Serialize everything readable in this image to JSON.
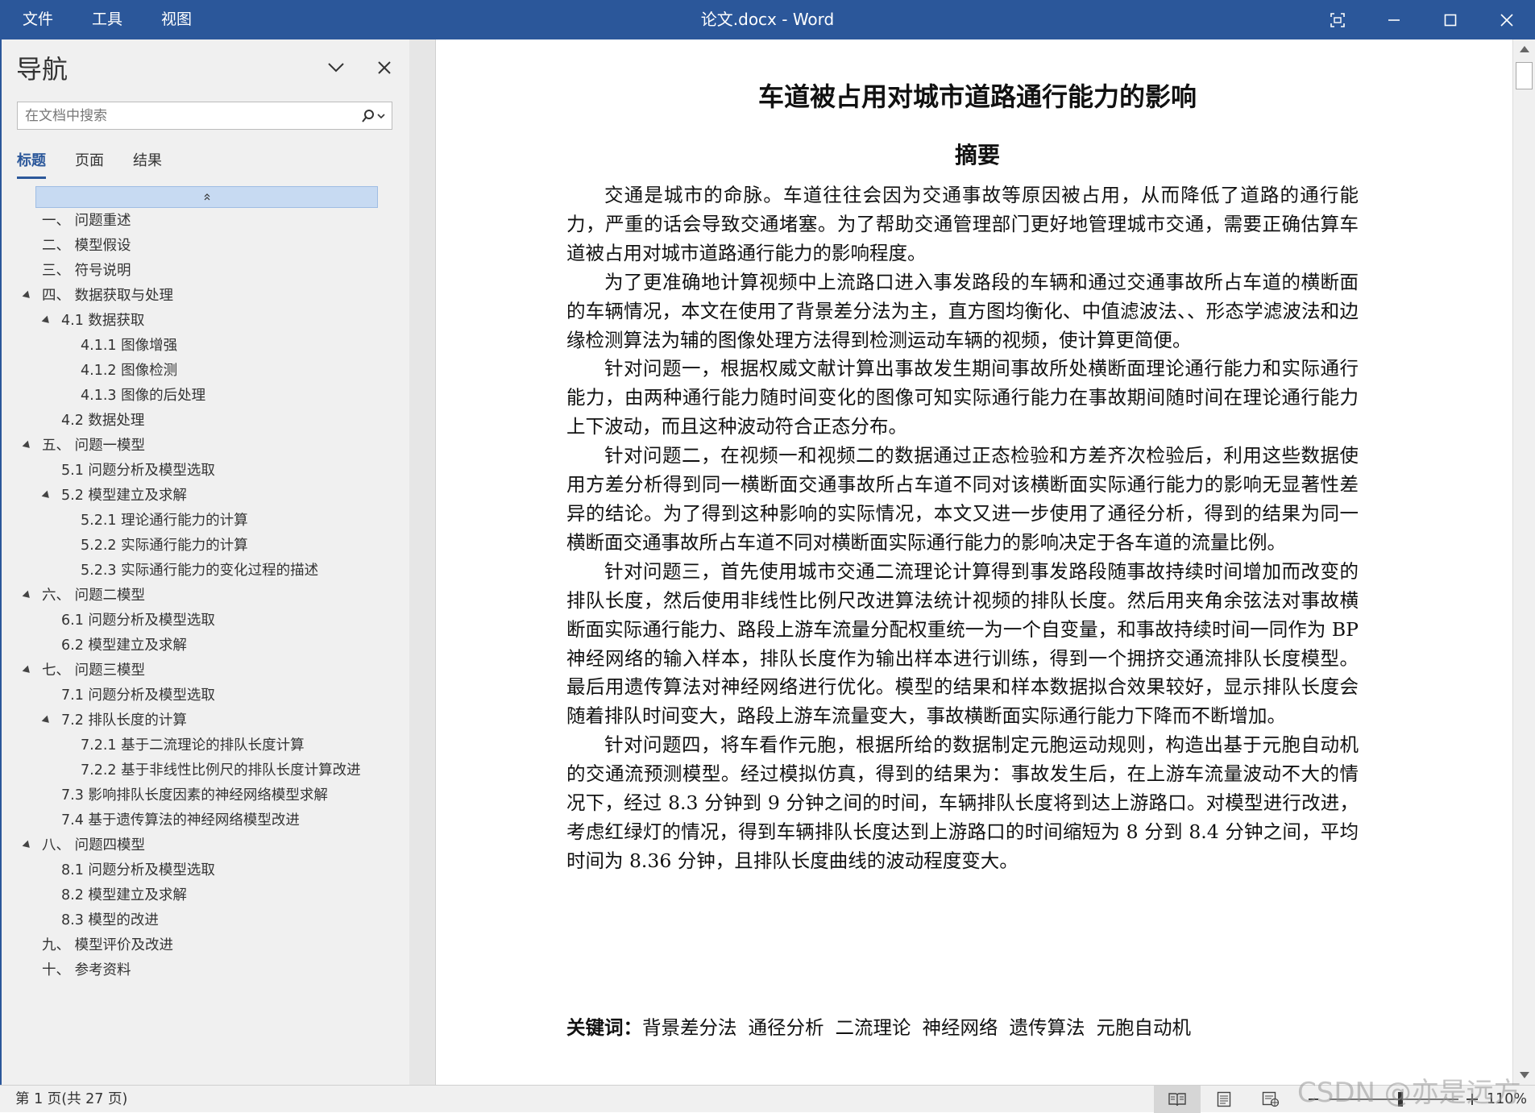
{
  "titlebar": {
    "menu": [
      "文件",
      "工具",
      "视图"
    ],
    "title": "论文.docx  -  Word",
    "accent": "#2b579a"
  },
  "nav": {
    "title": "导航",
    "search_placeholder": "在文档中搜索",
    "tabs": [
      "标题",
      "页面",
      "结果"
    ],
    "active_tab": "标题",
    "items": [
      {
        "level": 1,
        "text": "一、 问题重述",
        "expandable": false
      },
      {
        "level": 1,
        "text": "二、 模型假设",
        "expandable": false
      },
      {
        "level": 1,
        "text": "三、 符号说明",
        "expandable": false
      },
      {
        "level": 1,
        "text": "四、 数据获取与处理",
        "expandable": true
      },
      {
        "level": 2,
        "text": "4.1 数据获取",
        "expandable": true
      },
      {
        "level": 3,
        "text": "4.1.1 图像增强",
        "expandable": false
      },
      {
        "level": 3,
        "text": "4.1.2 图像检测",
        "expandable": false
      },
      {
        "level": 3,
        "text": "4.1.3 图像的后处理",
        "expandable": false
      },
      {
        "level": 2,
        "text": "4.2 数据处理",
        "expandable": false
      },
      {
        "level": 1,
        "text": "五、 问题一模型",
        "expandable": true
      },
      {
        "level": 2,
        "text": "5.1 问题分析及模型选取",
        "expandable": false
      },
      {
        "level": 2,
        "text": "5.2 模型建立及求解",
        "expandable": true
      },
      {
        "level": 3,
        "text": "5.2.1 理论通行能力的计算",
        "expandable": false
      },
      {
        "level": 3,
        "text": "5.2.2 实际通行能力的计算",
        "expandable": false
      },
      {
        "level": 3,
        "text": "5.2.3 实际通行能力的变化过程的描述",
        "expandable": false
      },
      {
        "level": 1,
        "text": "六、 问题二模型",
        "expandable": true
      },
      {
        "level": 2,
        "text": "6.1 问题分析及模型选取",
        "expandable": false
      },
      {
        "level": 2,
        "text": "6.2 模型建立及求解",
        "expandable": false
      },
      {
        "level": 1,
        "text": "七、 问题三模型",
        "expandable": true
      },
      {
        "level": 2,
        "text": "7.1 问题分析及模型选取",
        "expandable": false
      },
      {
        "level": 2,
        "text": "7.2 排队长度的计算",
        "expandable": true
      },
      {
        "level": 3,
        "text": "7.2.1 基于二流理论的排队长度计算",
        "expandable": false
      },
      {
        "level": 3,
        "text": "7.2.2 基于非线性比例尺的排队长度计算改进",
        "expandable": false
      },
      {
        "level": 2,
        "text": "7.3 影响排队长度因素的神经网络模型求解",
        "expandable": false
      },
      {
        "level": 2,
        "text": "7.4 基于遗传算法的神经网络模型改进",
        "expandable": false
      },
      {
        "level": 1,
        "text": "八、 问题四模型",
        "expandable": true
      },
      {
        "level": 2,
        "text": "8.1 问题分析及模型选取",
        "expandable": false
      },
      {
        "level": 2,
        "text": "8.2 模型建立及求解",
        "expandable": false
      },
      {
        "level": 2,
        "text": "8.3 模型的改进",
        "expandable": false
      },
      {
        "level": 1,
        "text": "九、 模型评价及改进",
        "expandable": false
      },
      {
        "level": 1,
        "text": "十、 参考资料",
        "expandable": false
      }
    ]
  },
  "document": {
    "title": "车道被占用对城市道路通行能力的影响",
    "abstract_heading": "摘要",
    "paragraphs": [
      "交通是城市的命脉。车道往往会因为交通事故等原因被占用，从而降低了道路的通行能力，严重的话会导致交通堵塞。为了帮助交通管理部门更好地管理城市交通，需要正确估算车道被占用对城市道路通行能力的影响程度。",
      "为了更准确地计算视频中上流路口进入事发路段的车辆和通过交通事故所占车道的横断面的车辆情况，本文在使用了背景差分法为主，直方图均衡化、中值滤波法、、形态学滤波法和边缘检测算法为辅的图像处理方法得到检测运动车辆的视频，使计算更简便。",
      "针对问题一，根据权威文献计算出事故发生期间事故所处横断面理论通行能力和实际通行能力，由两种通行能力随时间变化的图像可知实际通行能力在事故期间随时间在理论通行能力上下波动，而且这种波动符合正态分布。",
      "针对问题二，在视频一和视频二的数据通过正态检验和方差齐次检验后，利用这些数据使用方差分析得到同一横断面交通事故所占车道不同对该横断面实际通行能力的影响无显著性差异的结论。为了得到这种影响的实际情况，本文又进一步使用了通径分析，得到的结果为同一横断面交通事故所占车道不同对横断面实际通行能力的影响决定于各车道的流量比例。",
      "针对问题三，首先使用城市交通二流理论计算得到事发路段随事故持续时间增加而改变的排队长度，然后使用非线性比例尺改进算法统计视频的排队长度。然后用夹角余弦法对事故横断面实际通行能力、路段上游车流量分配权重统一为一个自变量，和事故持续时间一同作为 BP 神经网络的输入样本，排队长度作为输出样本进行训练，得到一个拥挤交通流排队长度模型。最后用遗传算法对神经网络进行优化。模型的结果和样本数据拟合效果较好，显示排队长度会随着排队时间变大，路段上游车流量变大，事故横断面实际通行能力下降而不断增加。",
      "针对问题四，将车看作元胞，根据所给的数据制定元胞运动规则，构造出基于元胞自动机的交通流预测模型。经过模拟仿真，得到的结果为：事故发生后，在上游车流量波动不大的情况下，经过 8.3 分钟到 9 分钟之间的时间，车辆排队长度将到达上游路口。对模型进行改进，考虑红绿灯的情况，得到车辆排队长度达到上游路口的时间缩短为 8 分到 8.4 分钟之间，平均时间为 8.36 分钟，且排队长度曲线的波动程度变大。"
    ],
    "keywords_label": "关键词：",
    "keywords": [
      "背景差分法",
      "通径分析",
      "二流理论",
      "神经网络",
      "遗传算法",
      "元胞自动机"
    ]
  },
  "status": {
    "page": "第 1 页(共 27 页)",
    "zoom": "110%",
    "zoom_fraction": 0.55
  },
  "watermark": "CSDN @亦是远方"
}
